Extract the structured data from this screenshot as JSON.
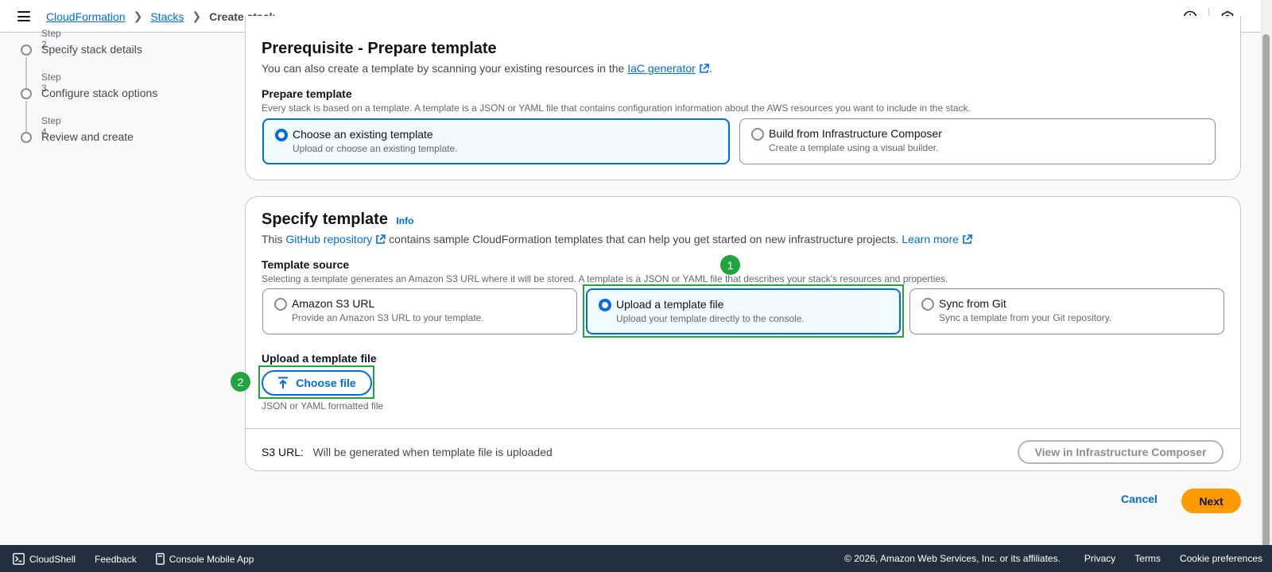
{
  "topbar": {
    "breadcrumbs": [
      "CloudFormation",
      "Stacks",
      "Create stack"
    ]
  },
  "steps": [
    {
      "num": "Step 2",
      "label": "Specify stack details"
    },
    {
      "num": "Step 3",
      "label": "Configure stack options"
    },
    {
      "num": "Step 4",
      "label": "Review and create"
    }
  ],
  "prerequisite": {
    "title": "Prerequisite - Prepare template",
    "desc_before": "You can also create a template by scanning your existing resources in the",
    "desc_link": "IaC generator",
    "desc_after": ".",
    "field_label": "Prepare template",
    "field_desc": "Every stack is based on a template. A template is a JSON or YAML file that contains configuration information about the AWS resources you want to include in the stack.",
    "options": [
      {
        "title": "Choose an existing template",
        "desc": "Upload or choose an existing template.",
        "selected": true
      },
      {
        "title": "Build from Infrastructure Composer",
        "desc": "Create a template using a visual builder.",
        "selected": false
      }
    ]
  },
  "specify": {
    "title": "Specify template",
    "info": "Info",
    "desc_before": "This",
    "github_link": "GitHub repository",
    "desc_middle": "contains sample CloudFormation templates that can help you get started on new infrastructure projects.",
    "learn_more": "Learn more",
    "source_label": "Template source",
    "source_desc": "Selecting a template generates an Amazon S3 URL where it will be stored. A template is a JSON or YAML file that describes your stack's resources and properties.",
    "options": [
      {
        "title": "Amazon S3 URL",
        "desc": "Provide an Amazon S3 URL to your template.",
        "selected": false
      },
      {
        "title": "Upload a template file",
        "desc": "Upload your template directly to the console.",
        "selected": true
      },
      {
        "title": "Sync from Git",
        "desc": "Sync a template from your Git repository.",
        "selected": false
      }
    ],
    "upload_label": "Upload a template file",
    "choose_file": "Choose file",
    "upload_hint": "JSON or YAML formatted file",
    "s3_label": "S3 URL:",
    "s3_value": "Will be generated when template file is uploaded",
    "view_button": "View in Infrastructure Composer"
  },
  "annotations": {
    "badge1": "1",
    "badge2": "2",
    "color": "#21a33d"
  },
  "actions": {
    "cancel": "Cancel",
    "next": "Next"
  },
  "bottombar": {
    "cloudshell": "CloudShell",
    "feedback": "Feedback",
    "mobile": "Console Mobile App",
    "copyright": "© 2026, Amazon Web Services, Inc. or its affiliates.",
    "privacy": "Privacy",
    "terms": "Terms",
    "cookie": "Cookie preferences"
  },
  "colors": {
    "link": "#006ce0",
    "primary": "#ff9900",
    "footer_bg": "#232f3e"
  }
}
